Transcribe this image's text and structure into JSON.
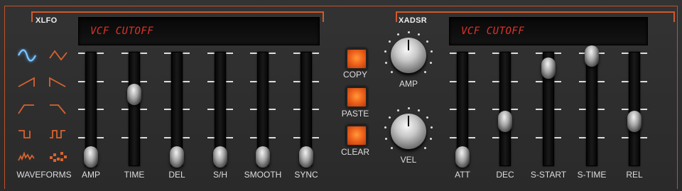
{
  "xlfo": {
    "title": "XLFO",
    "display": "VCF CUTOFF",
    "waveforms_label": "WAVEFORMS",
    "waveforms": [
      "sine-icon",
      "triangle-icon",
      "ramp-up-icon",
      "ramp-down-icon",
      "attack-decay-icon",
      "decay-attack-icon",
      "square-icon",
      "pulse-icon",
      "noise-icon",
      "random-steps-icon"
    ],
    "sliders": [
      {
        "label": "AMP",
        "value": 0.0
      },
      {
        "label": "TIME",
        "value": 0.62
      },
      {
        "label": "DEL",
        "value": 0.0
      },
      {
        "label": "S/H",
        "value": 0.0
      },
      {
        "label": "SMOOTH",
        "value": 0.0
      },
      {
        "label": "SYNC",
        "value": 0.0
      }
    ]
  },
  "buttons": [
    {
      "label": "COPY"
    },
    {
      "label": "PASTE"
    },
    {
      "label": "CLEAR"
    }
  ],
  "xadsr": {
    "title": "XADSR",
    "display": "VCF CUTOFF",
    "knobs": [
      {
        "label": "AMP"
      },
      {
        "label": "VEL"
      }
    ],
    "sliders": [
      {
        "label": "ATT",
        "value": 0.0
      },
      {
        "label": "DEC",
        "value": 0.35
      },
      {
        "label": "S-START",
        "value": 0.88
      },
      {
        "label": "S-TIME",
        "value": 1.0
      },
      {
        "label": "REL",
        "value": 0.35
      }
    ]
  },
  "colors": {
    "accent": "#d0592c",
    "lcd_text": "#e0322a",
    "button": "#f0641c"
  }
}
